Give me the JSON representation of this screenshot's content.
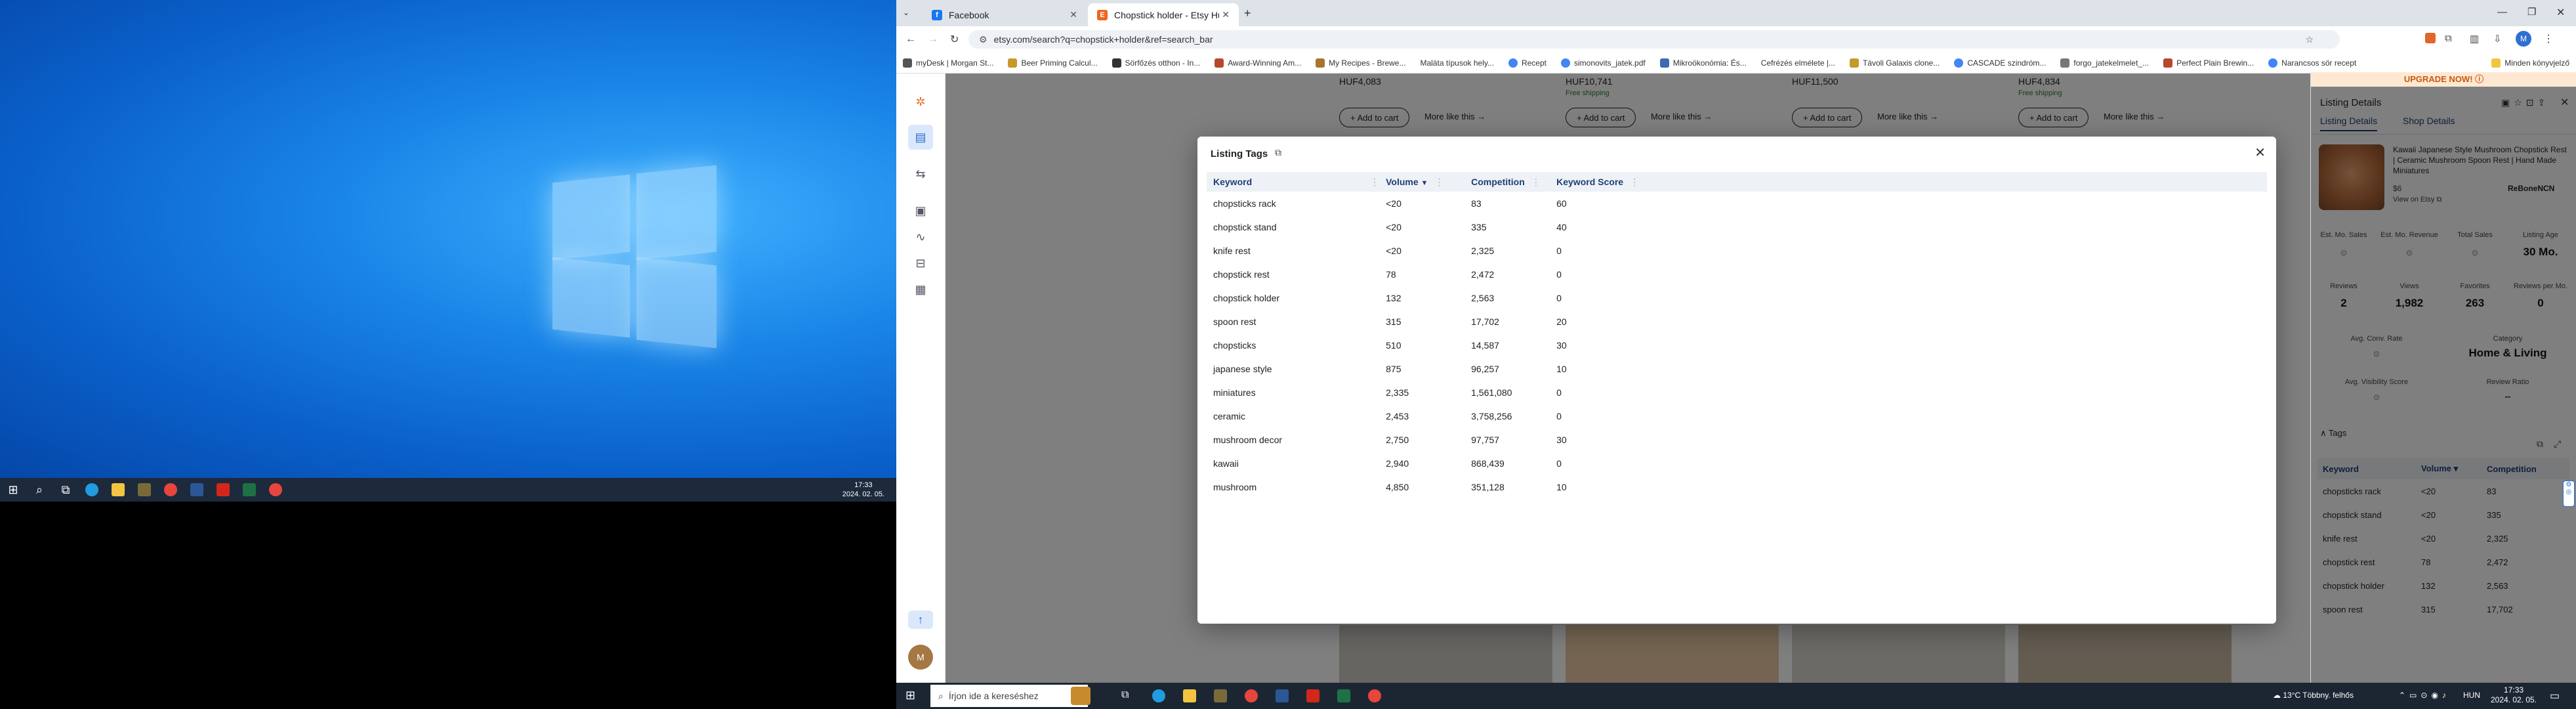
{
  "left_taskbar": {
    "time": "17:33",
    "date": "2024. 02. 05."
  },
  "browser": {
    "tabs": [
      {
        "title": "Facebook",
        "active": false,
        "color": "#1877f2",
        "icon": "facebook-icon"
      },
      {
        "title": "Chopstick holder - Etsy Hungary",
        "active": true,
        "color": "#f1641e",
        "icon": "etsy-icon"
      }
    ],
    "url": "etsy.com/search?q=chopstick+holder&ref=search_bar",
    "bookmarks": [
      "myDesk | Morgan St...",
      "Beer Priming Calcul...",
      "Sörfőzés otthon - In...",
      "Award-Winning Am...",
      "My Recipes - Brewe...",
      "Maláta típusok hely...",
      "Recept",
      "simonovits_jatek.pdf",
      "Mikroökonómia: És...",
      "Cefrézés elmélete |...",
      "Távoli Galaxis clone...",
      "CASCADE szindróm...",
      "forgo_jatekelmelet_...",
      "Perfect Plain Brewin...",
      "Narancsos sör recept"
    ],
    "all_bookmarks": "Minden könyvjelző"
  },
  "background_products": {
    "prices": [
      "HUF4,083",
      "HUF10,741",
      "HUF11,500",
      "HUF4,834"
    ],
    "shipping": "Free shipping",
    "add_to_cart": "+ Add to cart",
    "more_like": "More like this →"
  },
  "modal": {
    "title": "Listing Tags",
    "columns": [
      "Keyword",
      "Volume",
      "Competition",
      "Keyword Score"
    ],
    "rows": [
      [
        "chopsticks rack",
        "<20",
        "83",
        "60"
      ],
      [
        "chopstick stand",
        "<20",
        "335",
        "40"
      ],
      [
        "knife rest",
        "<20",
        "2,325",
        "0"
      ],
      [
        "chopstick rest",
        "78",
        "2,472",
        "0"
      ],
      [
        "chopstick holder",
        "132",
        "2,563",
        "0"
      ],
      [
        "spoon rest",
        "315",
        "17,702",
        "20"
      ],
      [
        "chopsticks",
        "510",
        "14,587",
        "30"
      ],
      [
        "japanese style",
        "875",
        "96,257",
        "10"
      ],
      [
        "miniatures",
        "2,335",
        "1,561,080",
        "0"
      ],
      [
        "ceramic",
        "2,453",
        "3,758,256",
        "0"
      ],
      [
        "mushroom decor",
        "2,750",
        "97,757",
        "30"
      ],
      [
        "kawaii",
        "2,940",
        "868,439",
        "0"
      ],
      [
        "mushroom",
        "4,850",
        "351,128",
        "10"
      ]
    ]
  },
  "side_panel": {
    "upgrade": "UPGRADE NOW!",
    "title": "Listing Details",
    "tabs": [
      "Listing Details",
      "Shop Details"
    ],
    "product_title": "Kawaii Japanese Style Mushroom Chopstick Rest | Ceramic Mushroom Spoon Rest | Hand Made Miniatures",
    "price_small": "$6",
    "view_on_etsy": "View on Etsy",
    "shop": "ReBoneNCN",
    "stats_row1_labels": [
      "Est. Mo. Sales",
      "Est. Mo. Revenue",
      "Total Sales",
      "Listing Age"
    ],
    "stats_row1_values": [
      "",
      "",
      "",
      "30 Mo."
    ],
    "stats_row2_labels": [
      "Reviews",
      "Views",
      "Favorites",
      "Reviews per Mo."
    ],
    "stats_row2_values": [
      "2",
      "1,982",
      "263",
      "0"
    ],
    "conv_label": "Avg. Conv. Rate",
    "category_label": "Category",
    "category_value": "Home & Living",
    "visibility_label": "Avg. Visibility Score",
    "review_ratio_label": "Review Ratio",
    "review_ratio_value": "--",
    "tags_label": "Tags",
    "tags_columns": [
      "Keyword",
      "Volume",
      "Competition"
    ],
    "tags_rows": [
      [
        "chopsticks rack",
        "<20",
        "83"
      ],
      [
        "chopstick stand",
        "<20",
        "335"
      ],
      [
        "knife rest",
        "<20",
        "2,325"
      ],
      [
        "chopstick rest",
        "78",
        "2,472"
      ],
      [
        "chopstick holder",
        "132",
        "2,563"
      ],
      [
        "spoon rest",
        "315",
        "17,702"
      ]
    ]
  },
  "right_taskbar": {
    "search_placeholder": "Írjon ide a kereséshez",
    "weather": "13°C  Többny. felhős",
    "language": "HUN",
    "time": "17:33",
    "date": "2024. 02. 05."
  }
}
